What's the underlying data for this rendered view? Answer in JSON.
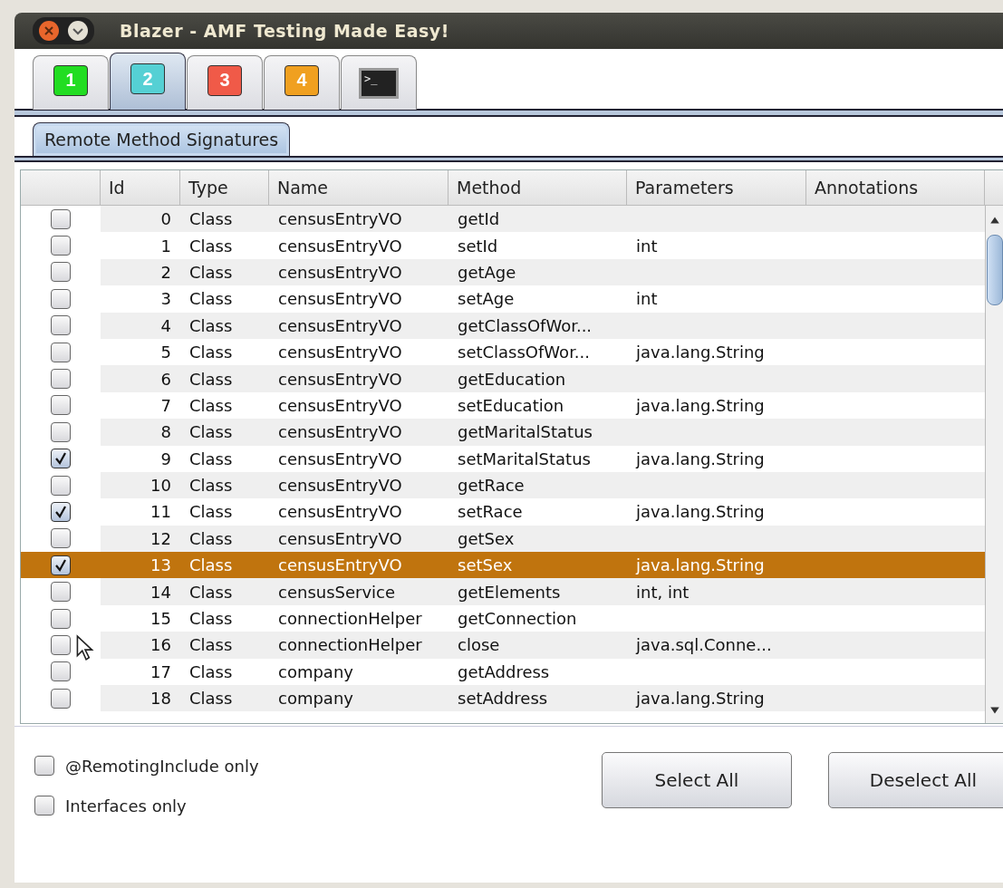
{
  "window": {
    "title": "Blazer - AMF Testing Made Easy!"
  },
  "tabs": [
    {
      "kind": "number",
      "label": "1",
      "color": "#22dd22",
      "selected": false
    },
    {
      "kind": "number",
      "label": "2",
      "color": "#55d0d4",
      "selected": true
    },
    {
      "kind": "number",
      "label": "3",
      "color": "#f05a48",
      "selected": false
    },
    {
      "kind": "number",
      "label": "4",
      "color": "#f0a020",
      "selected": false
    },
    {
      "kind": "terminal",
      "label": ">_",
      "selected": false
    }
  ],
  "subtabs": [
    {
      "label": "Remote Method Signatures",
      "selected": true
    }
  ],
  "table": {
    "columns": [
      "Id",
      "Type",
      "Name",
      "Method",
      "Parameters",
      "Annotations"
    ],
    "rows": [
      {
        "checked": false,
        "selected": false,
        "cells": [
          "0",
          "Class",
          "censusEntryVO",
          "getId",
          ""
        ]
      },
      {
        "checked": false,
        "selected": false,
        "cells": [
          "1",
          "Class",
          "censusEntryVO",
          "setId",
          "int"
        ]
      },
      {
        "checked": false,
        "selected": false,
        "cells": [
          "2",
          "Class",
          "censusEntryVO",
          "getAge",
          ""
        ]
      },
      {
        "checked": false,
        "selected": false,
        "cells": [
          "3",
          "Class",
          "censusEntryVO",
          "setAge",
          "int"
        ]
      },
      {
        "checked": false,
        "selected": false,
        "cells": [
          "4",
          "Class",
          "censusEntryVO",
          "getClassOfWor...",
          ""
        ]
      },
      {
        "checked": false,
        "selected": false,
        "cells": [
          "5",
          "Class",
          "censusEntryVO",
          "setClassOfWor...",
          "java.lang.String"
        ]
      },
      {
        "checked": false,
        "selected": false,
        "cells": [
          "6",
          "Class",
          "censusEntryVO",
          "getEducation",
          ""
        ]
      },
      {
        "checked": false,
        "selected": false,
        "cells": [
          "7",
          "Class",
          "censusEntryVO",
          "setEducation",
          "java.lang.String"
        ]
      },
      {
        "checked": false,
        "selected": false,
        "cells": [
          "8",
          "Class",
          "censusEntryVO",
          "getMaritalStatus",
          ""
        ]
      },
      {
        "checked": true,
        "selected": false,
        "cells": [
          "9",
          "Class",
          "censusEntryVO",
          "setMaritalStatus",
          "java.lang.String"
        ]
      },
      {
        "checked": false,
        "selected": false,
        "cells": [
          "10",
          "Class",
          "censusEntryVO",
          "getRace",
          ""
        ]
      },
      {
        "checked": true,
        "selected": false,
        "cells": [
          "11",
          "Class",
          "censusEntryVO",
          "setRace",
          "java.lang.String"
        ]
      },
      {
        "checked": false,
        "selected": false,
        "cells": [
          "12",
          "Class",
          "censusEntryVO",
          "getSex",
          ""
        ]
      },
      {
        "checked": true,
        "selected": true,
        "cells": [
          "13",
          "Class",
          "censusEntryVO",
          "setSex",
          "java.lang.String"
        ]
      },
      {
        "checked": false,
        "selected": false,
        "cells": [
          "14",
          "Class",
          "censusService",
          "getElements",
          "int, int"
        ]
      },
      {
        "checked": false,
        "selected": false,
        "cells": [
          "15",
          "Class",
          "connectionHelper",
          "getConnection",
          ""
        ]
      },
      {
        "checked": false,
        "selected": false,
        "cells": [
          "16",
          "Class",
          "connectionHelper",
          "close",
          "java.sql.Conne..."
        ]
      },
      {
        "checked": false,
        "selected": false,
        "cells": [
          "17",
          "Class",
          "company",
          "getAddress",
          ""
        ]
      },
      {
        "checked": false,
        "selected": false,
        "cells": [
          "18",
          "Class",
          "company",
          "setAddress",
          "java.lang.String"
        ]
      }
    ]
  },
  "filters": [
    {
      "label": "@RemotingInclude only",
      "checked": false
    },
    {
      "label": "Interfaces only",
      "checked": false
    }
  ],
  "buttons": [
    "Select All",
    "Deselect All"
  ]
}
